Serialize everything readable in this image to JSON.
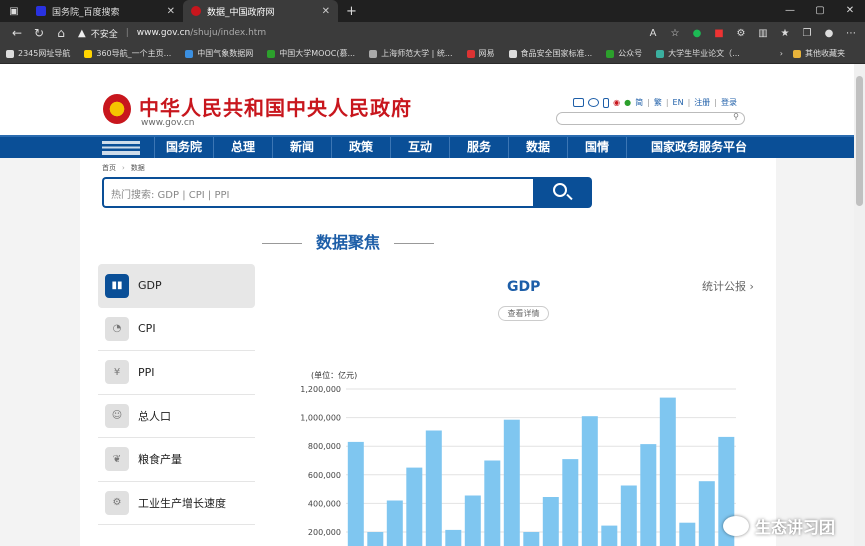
{
  "browser": {
    "tabs": [
      {
        "title": "国务院_百度搜索",
        "favicon_color": "#2932e1"
      },
      {
        "title": "数据_中国政府网",
        "favicon_color": "#c8161d"
      }
    ],
    "new_tab": "+",
    "window_controls": [
      "—",
      "▢",
      "✕"
    ],
    "address": {
      "security": "不安全",
      "url": "www.gov.cn",
      "path": "/shuju/index.htm"
    },
    "bookmarks": [
      "2345网址导航",
      "360导航_一个主页...",
      "中国气象数据网",
      "中国大学MOOC(慕...",
      "上海师范大学 | 统...",
      "网易",
      "食品安全国家标准...",
      "公众号",
      "大学生毕业论文（...",
      "其他收藏夹"
    ]
  },
  "header": {
    "site_title": "中华人民共和国中央人民政府",
    "site_url": "www.gov.cn",
    "links": [
      "简",
      "繁",
      "EN",
      "注册",
      "登录"
    ]
  },
  "nav": {
    "items": [
      "国务院",
      "总理",
      "新闻",
      "政策",
      "互动",
      "服务",
      "数据",
      "国情",
      "国家政务服务平台"
    ]
  },
  "breadcrumb": {
    "home": "首页",
    "current": "数据"
  },
  "search": {
    "placeholder": "热门搜索:  GDP   |   CPI   |   PPI"
  },
  "section_title": "数据聚焦",
  "sidebar": {
    "items": [
      {
        "label": "GDP",
        "icon": "bar-chart-icon",
        "active": true
      },
      {
        "label": "CPI",
        "icon": "pie-chart-icon",
        "active": false
      },
      {
        "label": "PPI",
        "icon": "yuan-icon",
        "active": false
      },
      {
        "label": "总人口",
        "icon": "people-icon",
        "active": false
      },
      {
        "label": "粮食产量",
        "icon": "wheat-icon",
        "active": false
      },
      {
        "label": "工业生产增长速度",
        "icon": "factory-icon",
        "active": false
      }
    ]
  },
  "chart_panel": {
    "title": "GDP",
    "stat_link": "统计公报",
    "detail_button": "查看详情"
  },
  "watermark": "生态讲习团",
  "chart_data": {
    "type": "bar",
    "unit_label": "(单位：亿元)",
    "yticks": [
      "1,200,000",
      "1,000,000",
      "800,000",
      "600,000",
      "400,000",
      "200,000"
    ],
    "ylim": [
      0,
      1200000
    ],
    "values": [
      830000,
      200000,
      420000,
      650000,
      910000,
      215000,
      455000,
      700000,
      985000,
      200000,
      445000,
      710000,
      1010000,
      245000,
      525000,
      815000,
      1140000,
      265000,
      555000,
      865000
    ],
    "color": "#7fc6f0"
  }
}
